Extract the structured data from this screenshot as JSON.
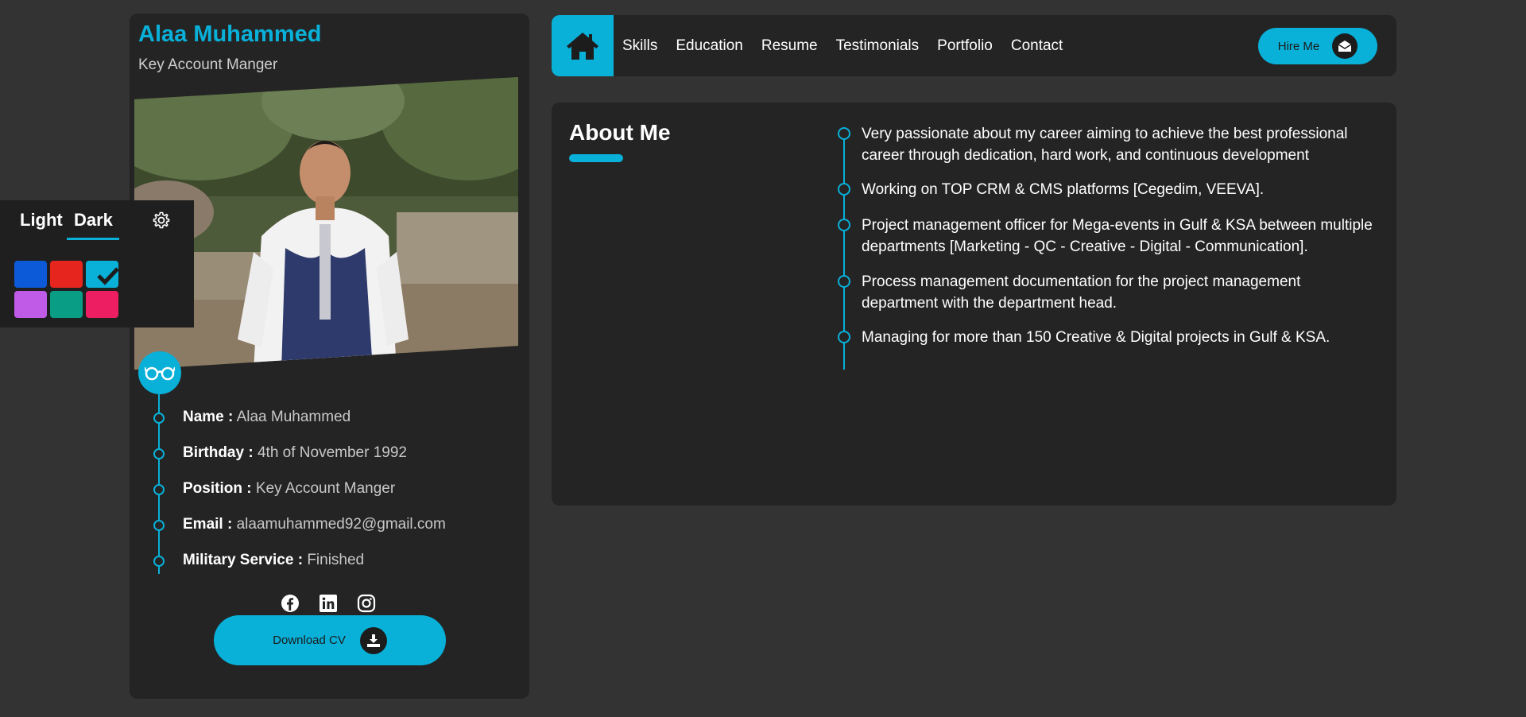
{
  "profile": {
    "name": "Alaa Muhammed",
    "role": "Key Account Manger",
    "info": [
      {
        "key": "Name :",
        "value": "Alaa Muhammed"
      },
      {
        "key": "Birthday :",
        "value": "4th of November 1992"
      },
      {
        "key": "Position :",
        "value": "Key Account Manger"
      },
      {
        "key": "Email :",
        "value": "alaamuhammed92@gmail.com"
      },
      {
        "key": "Military Service :",
        "value": "Finished"
      }
    ],
    "socials": [
      "facebook-icon",
      "linkedin-icon",
      "instagram-icon"
    ],
    "download_label": "Download CV"
  },
  "theme": {
    "light_label": "Light",
    "dark_label": "Dark",
    "active_mode": "Dark",
    "swatches": [
      "#0d5ad9",
      "#e6251f",
      "#09b0d8",
      "#bf5be6",
      "#0a9d85",
      "#ee1e63"
    ],
    "selected_swatch": "#09b0d8"
  },
  "nav": {
    "links": [
      "Skills",
      "Education",
      "Resume",
      "Testimonials",
      "Portfolio",
      "Contact"
    ],
    "hire_label": "Hire Me"
  },
  "about": {
    "title": "About Me",
    "items": [
      "Very passionate about my career aiming to achieve the best professional career through dedication, hard work, and continuous development",
      "Working on TOP CRM & CMS platforms [Cegedim, VEEVA].",
      "Project management officer for Mega-events in Gulf & KSA between multiple departments [Marketing - QC - Creative - Digital - Communication].",
      "Process management documentation for the project management department with the department head.",
      "Managing for more than 150 Creative & Digital projects in Gulf & KSA."
    ]
  },
  "colors": {
    "accent": "#09b0d8",
    "background": "#333333",
    "card": "#242424"
  }
}
